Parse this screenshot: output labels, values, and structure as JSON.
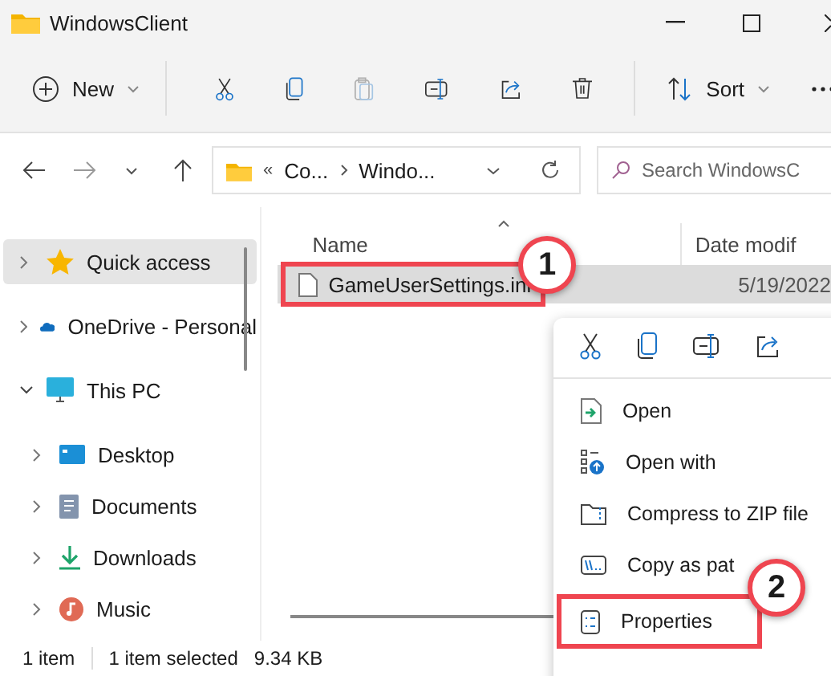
{
  "window": {
    "title": "WindowsClient"
  },
  "toolbar": {
    "new_label": "New",
    "sort_label": "Sort",
    "paste_disabled": true
  },
  "address": {
    "overflow": "«",
    "segments": [
      "Co...",
      "Windo..."
    ]
  },
  "search": {
    "placeholder": "Search WindowsC"
  },
  "sidebar": {
    "items": [
      {
        "label": "Quick access",
        "kind": "star",
        "selected": true,
        "expanded": false
      },
      {
        "label": "OneDrive - Personal",
        "kind": "cloud",
        "selected": false,
        "expanded": false
      },
      {
        "label": "This PC",
        "kind": "pc",
        "selected": false,
        "expanded": true,
        "children": [
          {
            "label": "Desktop",
            "kind": "desktop",
            "selected": false,
            "expanded": false
          },
          {
            "label": "Documents",
            "kind": "documents",
            "selected": false,
            "expanded": false
          },
          {
            "label": "Downloads",
            "kind": "downloads",
            "selected": false,
            "expanded": false
          },
          {
            "label": "Music",
            "kind": "music",
            "selected": false,
            "expanded": false
          }
        ]
      }
    ]
  },
  "file_list": {
    "columns": [
      "Name",
      "Date modif"
    ],
    "rows": [
      {
        "name": "GameUserSettings.ini",
        "date": "5/19/2022",
        "selected": true,
        "marked": true
      }
    ]
  },
  "context_menu": {
    "items": [
      {
        "label": "Open",
        "kind": "open",
        "marked": false
      },
      {
        "label": "Open with",
        "kind": "openwith",
        "marked": false
      },
      {
        "label": "Compress to ZIP file",
        "kind": "zip",
        "marked": false
      },
      {
        "label": "Copy as pat",
        "kind": "path",
        "marked": false
      },
      {
        "label": "Properties",
        "kind": "properties",
        "marked": true
      }
    ]
  },
  "annotations": [
    {
      "label": "1"
    },
    {
      "label": "2"
    }
  ],
  "status_bar": {
    "count": "1 item",
    "selection": "1 item selected",
    "size": "9.34 KB"
  }
}
